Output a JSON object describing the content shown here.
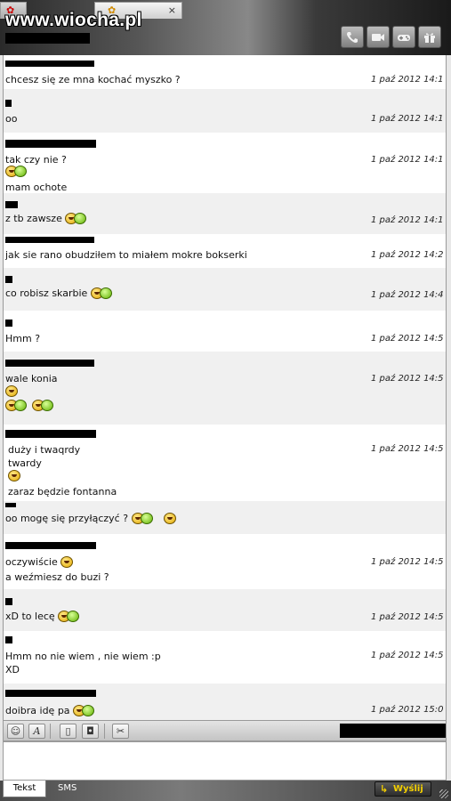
{
  "header": {
    "watermark": "www.wiocha.pl",
    "tabs": [
      {
        "name": "tab-1",
        "icon": "flower-icon"
      },
      {
        "name": "tab-2",
        "icon": "flower-icon",
        "close": "×"
      }
    ],
    "buttons": [
      {
        "name": "call-button",
        "icon": "phone-icon"
      },
      {
        "name": "video-button",
        "icon": "camera-icon"
      },
      {
        "name": "games-button",
        "icon": "gamepad-icon"
      },
      {
        "name": "gift-button",
        "icon": "gift-icon"
      }
    ]
  },
  "messages": [
    {
      "text": "chcesz się ze mna kochać myszko ?",
      "time": "1 paź 2012 14:1"
    },
    {
      "text": "oo",
      "time": "1 paź 2012 14:1"
    },
    {
      "text": "tak czy nie ?",
      "time": "1 paź 2012 14:1",
      "line2": "mam ochote"
    },
    {
      "text": "z tb zawsze",
      "time": "1 paź 2012 14:1"
    },
    {
      "text": "jak sie rano obudziłem to miałem mokre bokserki",
      "time": "1 paź 2012 14:2"
    },
    {
      "text": "co robisz skarbie",
      "time": "1 paź 2012 14:4"
    },
    {
      "text": "Hmm ?",
      "time": "1 paź 2012 14:5"
    },
    {
      "text": "wale konia",
      "time": "1 paź 2012 14:5"
    },
    {
      "text": "duży i twaqrdy",
      "time": "1 paź 2012 14:5",
      "line2": "twardy",
      "line3": "zaraz będzie fontanna"
    },
    {
      "text": "oo mogę się przyłączyć ?",
      "time": ""
    },
    {
      "text": "oczywiście",
      "time": "1 paź 2012 14:5",
      "line2": "a weźmiesz do buzi ?"
    },
    {
      "text": "xD to lecę",
      "time": "1 paź 2012 14:5"
    },
    {
      "text": "Hmm no nie wiem , nie wiem :p",
      "time": "1 paź 2012 14:5",
      "line2": "XD"
    },
    {
      "text": "doibra idę pa",
      "time": "1 paź 2012 15:0"
    }
  ],
  "toolbar": {
    "tools": [
      {
        "name": "emoticon-button",
        "glyph": "☺"
      },
      {
        "name": "font-button",
        "glyph": "A"
      },
      {
        "name": "file-button",
        "glyph": "▯"
      },
      {
        "name": "photo-button",
        "glyph": "◘"
      },
      {
        "name": "settings-button",
        "glyph": "✂"
      }
    ]
  },
  "footer": {
    "tab_text": "Tekst",
    "tab_sms": "SMS",
    "send_label": "Wyślij",
    "send_icon": "arrow-right-icon"
  },
  "colors": {
    "accent": "#f5d000",
    "alt_row": "#f0f0f0"
  }
}
